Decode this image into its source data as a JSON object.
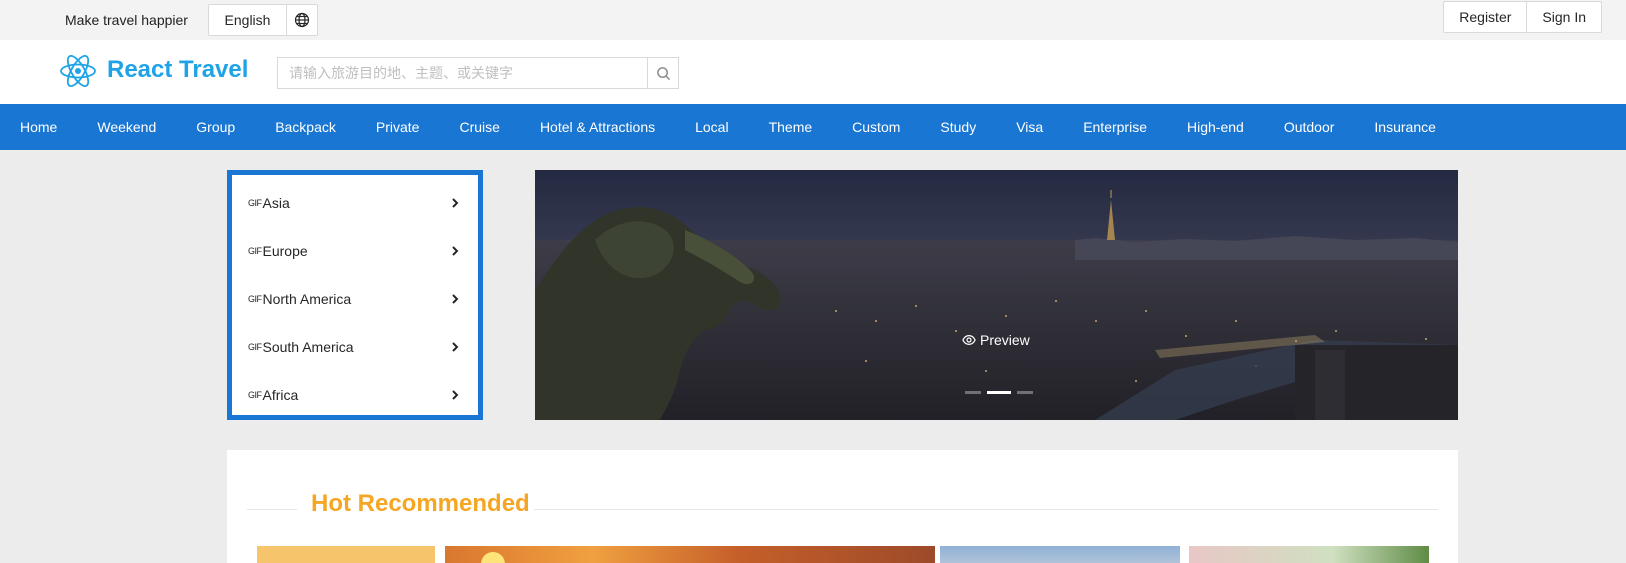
{
  "topbar": {
    "slogan": "Make travel happier",
    "language": "English",
    "register": "Register",
    "sign_in": "Sign In"
  },
  "header": {
    "brand": "React Travel",
    "search_placeholder": "请输入旅游目的地、主题、或关键字"
  },
  "nav": {
    "items": [
      "Home",
      "Weekend",
      "Group",
      "Backpack",
      "Private",
      "Cruise",
      "Hotel & Attractions",
      "Local",
      "Theme",
      "Custom",
      "Study",
      "Visa",
      "Enterprise",
      "High-end",
      "Outdoor",
      "Insurance"
    ]
  },
  "side_menu": {
    "gif_tag": "GIF",
    "items": [
      "Asia",
      "Europe",
      "North America",
      "South America",
      "Africa"
    ]
  },
  "carousel": {
    "preview_label": "Preview"
  },
  "recommended": {
    "title": "Hot Recommended"
  },
  "colors": {
    "brand": "#1ea4e6",
    "nav_bg": "#1976d2",
    "accent": "#f5a623"
  },
  "icons": [
    "react-logo-icon",
    "globe-icon",
    "search-icon",
    "chevron-right-icon",
    "eye-icon"
  ]
}
